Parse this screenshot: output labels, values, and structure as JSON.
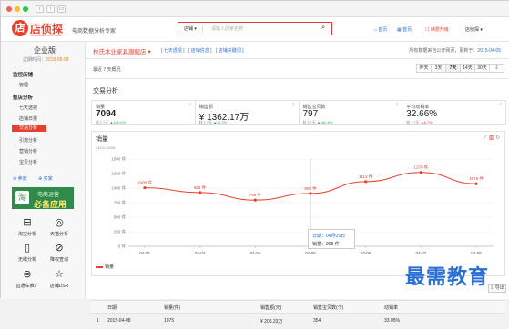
{
  "header": {
    "logo_mark": "店",
    "logo_text": "店侦探",
    "logo_sub": "DIANZHENTAN.COM",
    "tagline": "电商数据分析专家",
    "search_select": "店铺",
    "search_placeholder": "请输入店家名称",
    "link_home": "首页",
    "link_index": "首页",
    "link_buy": "续费升级",
    "user": "店侦探"
  },
  "sidebar": {
    "edition": "企业版",
    "expiry_label": "过期时间：",
    "expiry_date": "2018-08-08",
    "groups": [
      {
        "label": "监控店铺",
        "items": [
          "管理"
        ]
      },
      {
        "label": "整店分析",
        "items": [
          "七天透视",
          "店铺日报",
          "交易分析",
          "引流分析",
          "营销分析",
          "宝贝分析"
        ]
      }
    ],
    "active_item": "交易分析",
    "mini_links": [
      "卖家",
      "买家"
    ],
    "ad_icon": "淘",
    "ad_line1": "电商运营",
    "ad_line2": "必备应用",
    "tools": [
      {
        "label": "淘宝分析",
        "icon": "tray-icon"
      },
      {
        "label": "天猫分析",
        "icon": "cat-icon"
      },
      {
        "label": "无线分析",
        "icon": "phone-icon"
      },
      {
        "label": "降权查询",
        "icon": "shield-icon"
      },
      {
        "label": "直通车推广",
        "icon": "car-icon"
      },
      {
        "label": "店铺DSR",
        "icon": "star-icon"
      }
    ]
  },
  "main": {
    "shop_name": "林氏木业家具旗舰店",
    "shop_dropdown": "▾",
    "top_links": [
      "[ 七天透视 ]",
      "[ 店铺信息 ]",
      "[ 店铺关键词 ]"
    ],
    "note_prefix": "所有数据来自公开网页，更新于：",
    "note_date": "2015-04-05",
    "range_label": "最近 7 天概况",
    "range_buttons": [
      "昨天",
      "3天",
      "7天",
      "14天",
      "30天",
      "⇩"
    ],
    "range_active": "7天",
    "section_title": "交易分析",
    "kpis": [
      {
        "label": "销量",
        "value": "7094",
        "change_prefix": "较上7天",
        "change": "▲109.0%",
        "dir": "up"
      },
      {
        "label": "销售额",
        "value": "¥ 1362.17万",
        "change_prefix": "较上7天",
        "change": "▲11.2%",
        "dir": "up"
      },
      {
        "label": "销售宝贝数",
        "value": "797",
        "change_prefix": "较上7天",
        "change": "▲180.6%",
        "dir": "up"
      },
      {
        "label": "平均动销率",
        "value": "32.66%",
        "change_prefix": "较上7天",
        "change": "▲8.7%",
        "dir": "down"
      }
    ],
    "chart_title": "销量",
    "chart_date": "04/02-04/08",
    "tooltip_date": "日期：04月05日",
    "tooltip_value": "销量：908 件",
    "legend_label": "销量",
    "export_label": "导出",
    "table": {
      "headers": [
        "日期",
        "销量(件)",
        "销售额(元)",
        "销售宝贝数(个)",
        "动销率"
      ],
      "rows": [
        [
          "1",
          "2015-04-08",
          "1075",
          "¥ 206.33万",
          "354",
          "33.05%"
        ]
      ]
    }
  },
  "chart_data": {
    "type": "line",
    "categories": [
      "04-02",
      "04-03",
      "04-04",
      "04-05",
      "04-06",
      "04-07",
      "04-08"
    ],
    "series": [
      {
        "name": "销量",
        "values": [
          1005,
          924,
          795,
          908,
          1112,
          1270,
          1075
        ]
      }
    ],
    "point_labels": [
      "1005 件",
      "924 件",
      "795 件",
      "908 件",
      "1112 件",
      "1270 件",
      "1075 件"
    ],
    "y_ticks": [
      "0 件",
      "250 件",
      "500 件",
      "750 件",
      "1000 件",
      "1250 件",
      "1500 件"
    ],
    "ylim": [
      0,
      1500
    ],
    "grid": true,
    "legend": "bottom-left",
    "color": "#e8402f"
  },
  "watermark": "最需教育",
  "colors": {
    "accent": "#e8402f",
    "link": "#2a6fd6",
    "up": "#3aa853"
  }
}
